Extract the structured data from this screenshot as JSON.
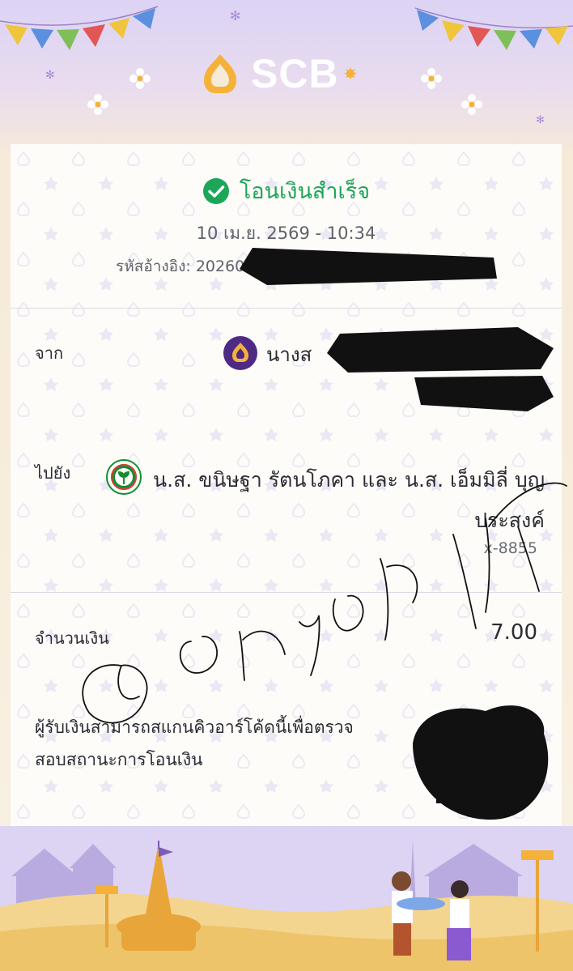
{
  "header": {
    "brand_name": "SCB",
    "colors": {
      "brand_gold": "#f4b23a",
      "brand_purple": "#4e2a84"
    }
  },
  "receipt": {
    "status_icon": "check-circle-icon",
    "status_text": "โอนเงินสำเร็จ",
    "status_color": "#1ca658",
    "datetime": "10 เม.ย. 2569 - 10:34",
    "reference": "รหัสอ้างอิง: 20260",
    "from": {
      "label": "จาก",
      "bank_icon": "scb-bank-icon",
      "name": "นางส"
    },
    "to": {
      "label": "ไปยัง",
      "bank_icon": "kbank-bank-icon",
      "name": "น.ส. ขนิษฐา รัตนโภคา และ น.ส. เอ็มมิลี่ บุญประสงค์",
      "account": "x-8855"
    },
    "amount": {
      "label": "จำนวนเงิน",
      "value": "7.00"
    },
    "qr_note": "ผู้รับเงินสามารถสแกนคิวอาร์โค้ดนี้เพื่อตรวจสอบสถานะการโอนเงิน"
  }
}
